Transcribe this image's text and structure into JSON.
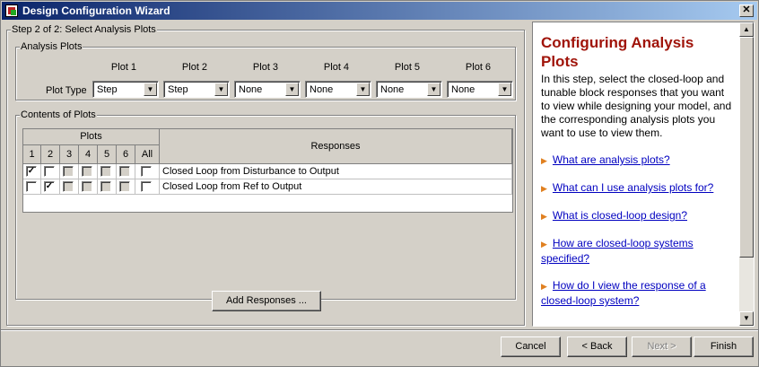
{
  "window": {
    "title": "Design Configuration Wizard",
    "close_glyph": "✕"
  },
  "step": {
    "title": "Step 2 of 2: Select Analysis Plots"
  },
  "analysis_plots": {
    "group_title": "Analysis Plots",
    "plot_type_label": "Plot Type",
    "headers": [
      "Plot 1",
      "Plot 2",
      "Plot 3",
      "Plot 4",
      "Plot 5",
      "Plot 6"
    ],
    "values": [
      "Step",
      "Step",
      "None",
      "None",
      "None",
      "None"
    ]
  },
  "contents": {
    "group_title": "Contents of Plots",
    "plots_header": "Plots",
    "responses_header": "Responses",
    "columns": [
      "1",
      "2",
      "3",
      "4",
      "5",
      "6",
      "All"
    ],
    "rows": [
      {
        "checks": [
          true,
          false,
          false,
          false,
          false,
          false,
          false
        ],
        "response": "Closed Loop from Disturbance to Output"
      },
      {
        "checks": [
          false,
          true,
          false,
          false,
          false,
          false,
          false
        ],
        "response": "Closed Loop from Ref to Output"
      }
    ],
    "add_button": "Add Responses ..."
  },
  "help": {
    "title": "Configuring Analysis Plots",
    "body": "In this step, select the closed-loop and tunable block responses that you want to view while designing your model, and the corresponding analysis plots you want to use to view them.",
    "links": [
      "What are analysis plots?",
      "What can I use analysis plots for?",
      "What is closed-loop design?",
      "How are closed-loop systems specified?",
      "How do I view the response of a closed-loop system?"
    ]
  },
  "buttons": {
    "cancel": "Cancel",
    "back": "< Back",
    "next": "Next >",
    "finish": "Finish"
  },
  "colors": {
    "title_bar": "#0a246a",
    "help_title": "#a0140a",
    "link": "#0000c0",
    "link_arrow": "#e08020"
  }
}
